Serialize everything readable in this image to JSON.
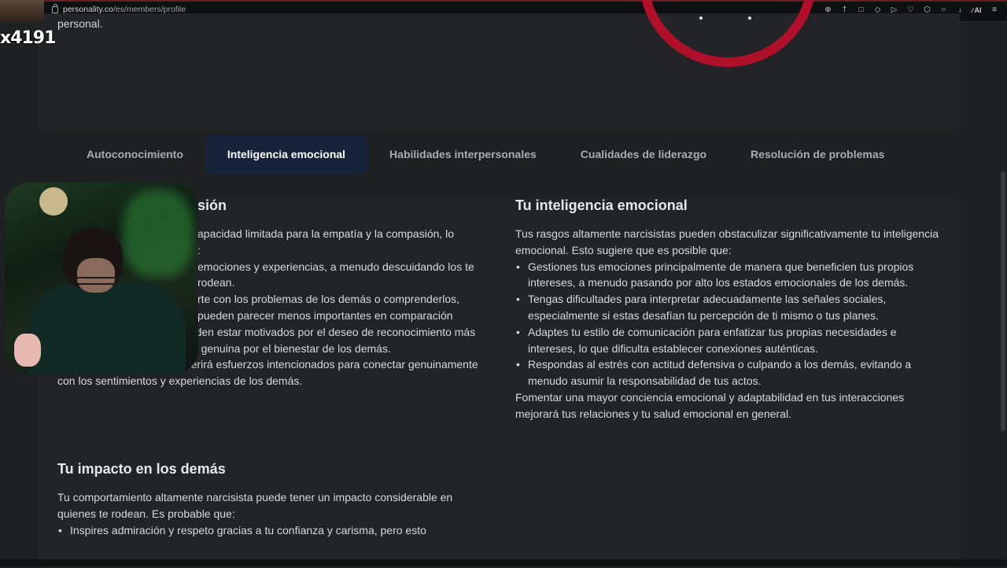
{
  "browser": {
    "url_domain": "personality.co",
    "url_path": "/es/members/profile",
    "icons": [
      "zoom-icon",
      "pin-icon",
      "reader-icon",
      "shield-icon",
      "play-icon",
      "heart-icon",
      "extensions-icon",
      "account-icon",
      "download-icon",
      "ai-tools-icon",
      "menu-icon"
    ],
    "ai_label": "AI"
  },
  "overlay": {
    "viewer_count": "x4191"
  },
  "intro": {
    "tail_text": "personal."
  },
  "tabs": [
    {
      "label": "Autoconocimiento",
      "active": false
    },
    {
      "label": "Inteligencia emocional",
      "active": true
    },
    {
      "label": "Habilidades interpersonales",
      "active": false
    },
    {
      "label": "Cualidades de liderazgo",
      "active": false
    },
    {
      "label": "Resolución de problemas",
      "active": false
    }
  ],
  "left": {
    "heading": "sión",
    "intro": "apacidad limitada para la empatía y la compasión, lo",
    "intro2": ":",
    "bullets": [
      "emociones y experiencias, a menudo descuidando los te rodean.",
      "rte con los problemas de los demás o comprenderlos, pueden parecer menos importantes en comparación",
      "Actos de bondad que pueden estar motivados por el deseo de reconocimiento más que por una preocupación genuina por el bienestar de los demás."
    ],
    "closing": "Desarrollar la empatía requerirá esfuerzos intencionados para conectar genuinamente con los sentimientos y experiencias de los demás."
  },
  "right": {
    "heading": "Tu inteligencia emocional",
    "intro": "Tus rasgos altamente narcisistas pueden obstaculizar significativamente tu inteligencia emocional. Esto sugiere que es posible que:",
    "bullets": [
      "Gestiones tus emociones principalmente de manera que beneficien tus propios intereses, a menudo pasando por alto los estados emocionales de los demás.",
      "Tengas dificultades para interpretar adecuadamente las señales sociales, especialmente si estas desafían tu percepción de ti mismo o tus planes.",
      "Adaptes tu estilo de comunicación para enfatizar tus propias necesidades e intereses, lo que dificulta establecer conexiones auténticas.",
      "Respondas al estrés con actitud defensiva o culpando a los demás, evitando a menudo asumir la responsabilidad de tus actos."
    ],
    "closing": "Fomentar una mayor conciencia emocional y adaptabilidad en tus interacciones mejorará tus relaciones y tu salud emocional en general."
  },
  "impact": {
    "heading": "Tu impacto en los demás",
    "intro": "Tu comportamiento altamente narcisista puede tener un impacto considerable en quienes te rodean. Es probable que:",
    "bullets": [
      "Inspires admiración y respeto gracias a tu confianza y carisma, pero esto"
    ]
  },
  "colors": {
    "accent_ring": "#b2102a",
    "active_tab_bg": "#17233a",
    "page_bg": "#1f2022"
  }
}
